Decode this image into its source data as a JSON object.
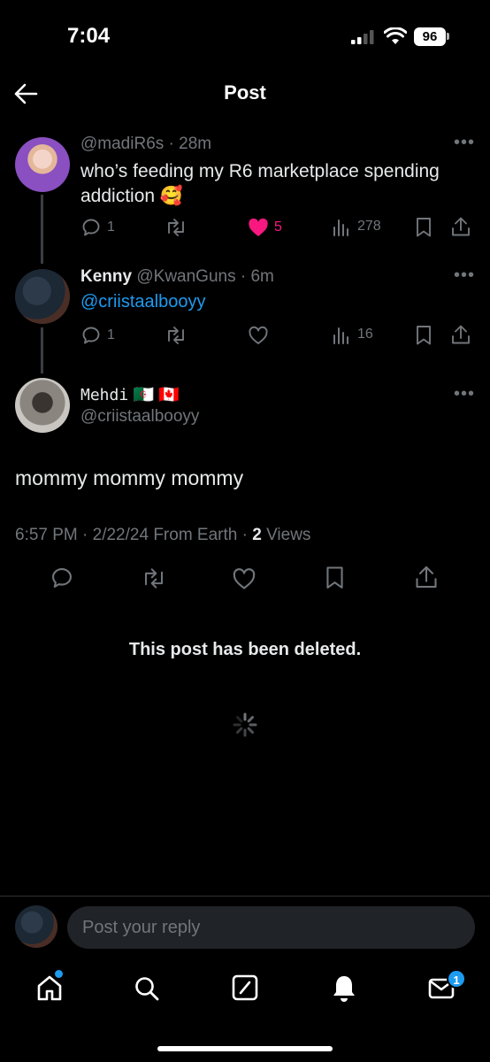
{
  "status_bar": {
    "time": "7:04",
    "battery": "96"
  },
  "header": {
    "title": "Post"
  },
  "posts": [
    {
      "handle": "@madiR6s",
      "time": "· 28m",
      "text_line1": "who’s feeding my R6 marketplace spending",
      "text_line2": "addiction 🥰",
      "replies": "1",
      "likes": "5",
      "views": "278"
    },
    {
      "name": "Kenny",
      "handle": "@KwanGuns",
      "time": "· 6m",
      "mention": "@criistaalbooyy",
      "replies": "1",
      "views": "16"
    }
  ],
  "main_post": {
    "name": "Mehdi",
    "flags": "🇩🇿 🇨🇦",
    "handle": "@criistaalbooyy",
    "text": "mommy mommy mommy",
    "timestamp": "6:57 PM · 2/22/24 From Earth ·",
    "views_count": "2",
    "views_label": "Views"
  },
  "deleted_notice": "This post has been deleted.",
  "reply": {
    "placeholder": "Post your reply"
  },
  "tabbar": {
    "messages_badge": "1"
  },
  "colors": {
    "accent": "#1d9bf0",
    "like": "#f91880",
    "muted": "#71767b",
    "background": "#000000"
  },
  "icons": [
    "back-arrow-icon",
    "more-icon",
    "reply-icon",
    "repost-icon",
    "like-icon",
    "views-icon",
    "bookmark-icon",
    "share-icon",
    "loading-spinner-icon",
    "home-icon",
    "search-icon",
    "grok-icon",
    "notifications-icon",
    "messages-icon"
  ]
}
